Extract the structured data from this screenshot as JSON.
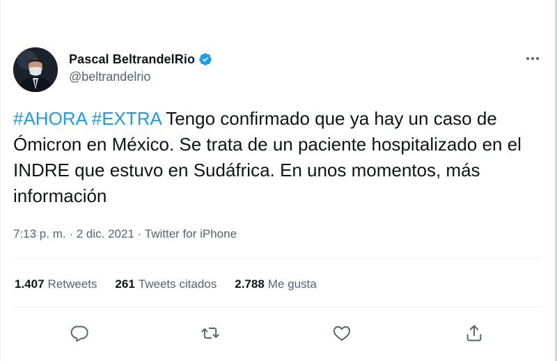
{
  "tweet": {
    "author": {
      "display_name": "Pascal BeltrandelRio",
      "handle": "@beltrandelrio",
      "verified": true,
      "avatar": "avatar-photo"
    },
    "hashtags": [
      "#AHORA",
      "#EXTRA"
    ],
    "body_text": "Tengo confirmado que ya hay un caso de Ómicron en México. Se trata de un paciente hospitalizado en el INDRE que estuvo en Sudáfrica. En unos momentos, más información",
    "time": "7:13 p. m.",
    "date": "2 dic. 2021",
    "separator": "·",
    "source": "Twitter for iPhone",
    "stats": [
      {
        "count": "1.407",
        "label": "Retweets"
      },
      {
        "count": "261",
        "label": "Tweets citados"
      },
      {
        "count": "2.788",
        "label": "Me gusta"
      }
    ],
    "actions": [
      "reply-icon",
      "retweet-icon",
      "like-icon",
      "share-icon"
    ],
    "more_menu": "more-options-icon"
  },
  "colors": {
    "link": "#1d9bf0",
    "text": "#0f1419",
    "secondary": "#536471",
    "verified": "#1d9bf0",
    "divider": "#eff3f4"
  }
}
